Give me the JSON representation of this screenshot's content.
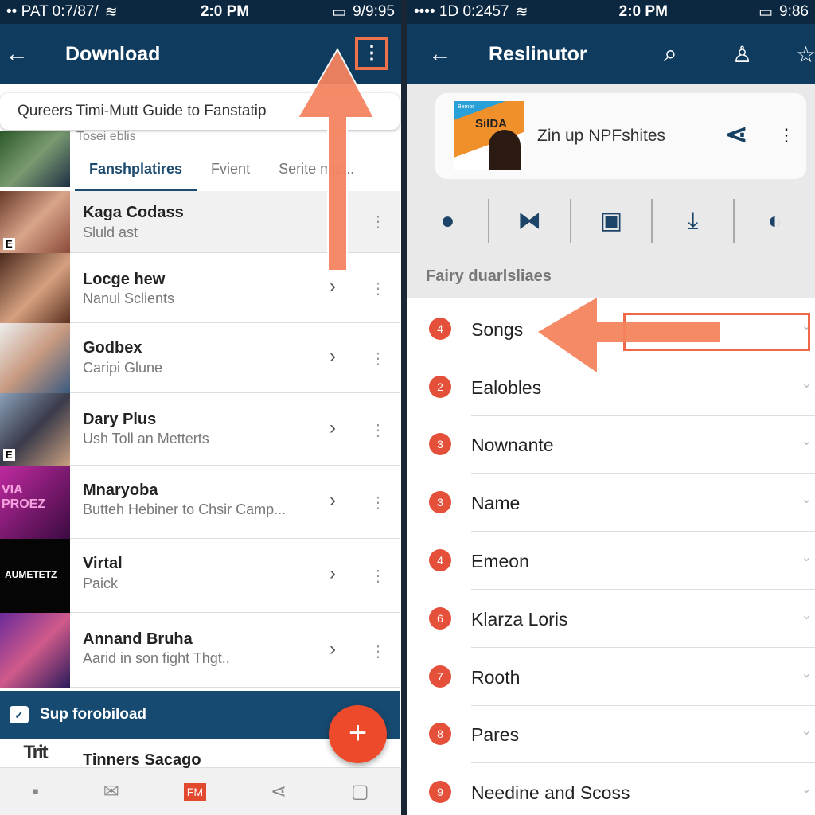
{
  "left": {
    "status": {
      "left": "•• PAT 0:7/87/",
      "time": "2:0 PM",
      "right": "9/9:95"
    },
    "appbar": {
      "title": "Download"
    },
    "search": {
      "value": "Qureers Timi-Mutt Guide to Fanstatip"
    },
    "subtitle": "Tosei eblis",
    "tabs": [
      {
        "label": "Fanshplatires",
        "active": true
      },
      {
        "label": "Fvient"
      },
      {
        "label": "Serite mis..."
      }
    ],
    "items": [
      {
        "title": "Kaga  Codass",
        "subtitle": "Sluld ast",
        "badge": "E"
      },
      {
        "title": "Locge hew",
        "subtitle": "Nanul Sclients"
      },
      {
        "title": "Godbex",
        "subtitle": "Caripi Glune"
      },
      {
        "title": "Dary Plus",
        "subtitle": "Ush Toll an Metterts",
        "badge": "E"
      },
      {
        "title": "Mnaryoba",
        "subtitle": "Butteh Hebiner to Chsir Camp...",
        "thumb_text": "VIA PROEZ"
      },
      {
        "title": "Virtal",
        "subtitle": "Paick",
        "thumb_text": "AUMETETZ"
      },
      {
        "title": "Annand Bruha",
        "subtitle": "Aarid in son fight Thgt.."
      }
    ],
    "banner": {
      "label": "Sup forobiload"
    },
    "partial_item": {
      "title": "Tinners Sacago",
      "thumb_text": "Trit"
    },
    "bottom_nav": {
      "active_label": "FM"
    },
    "colors": {
      "appbar": "#0f3b5f",
      "accent": "#ec4a2b",
      "annotation": "#f4845f"
    }
  },
  "right": {
    "status": {
      "left": "•••• 1D 0:2457",
      "time": "2:0 PM",
      "right": "9:86"
    },
    "appbar": {
      "title": "Reslinutor"
    },
    "card": {
      "title": "Zin up NPFshites",
      "art_text": "SiIDA",
      "art_small": "Bemor"
    },
    "section": "Fairy duarlsliaes",
    "items": [
      {
        "num": "4",
        "label": "Songs"
      },
      {
        "num": "2",
        "label": "Ealobles"
      },
      {
        "num": "3",
        "label": "Nownante"
      },
      {
        "num": "3",
        "label": "Name"
      },
      {
        "num": "4",
        "label": "Emeon"
      },
      {
        "num": "6",
        "label": "Klarza Loris"
      },
      {
        "num": "7",
        "label": "Rooth"
      },
      {
        "num": "8",
        "label": "Pares"
      },
      {
        "num": "9",
        "label": "Needine and Scoss"
      }
    ]
  }
}
